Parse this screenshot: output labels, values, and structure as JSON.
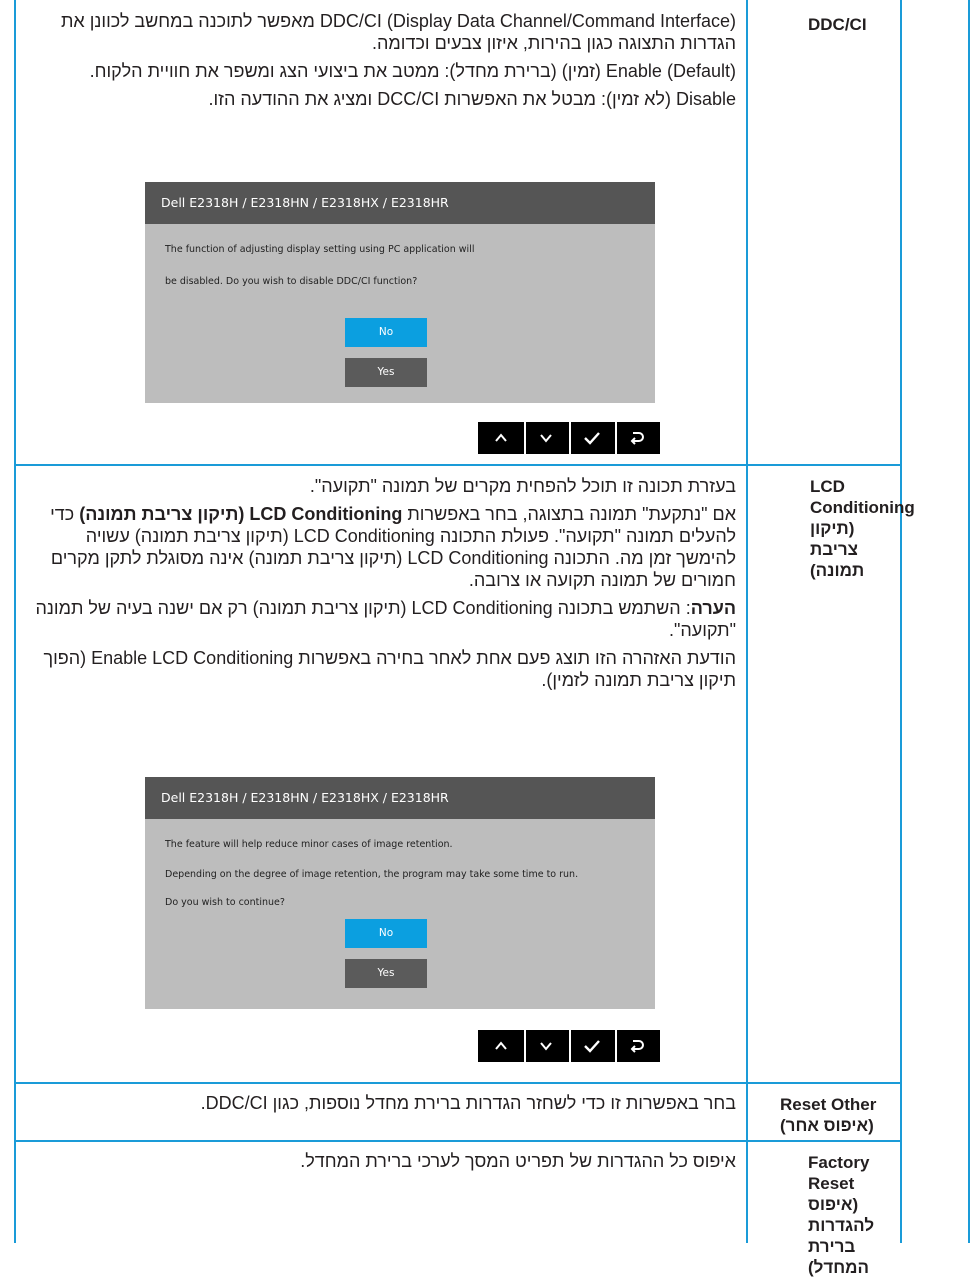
{
  "rows": [
    {
      "heading_en": "DDC/CI",
      "heading_he": "",
      "paragraphs": [
        "(Display Data Channel/Command Interface) DDC/CI מאפשר לתוכנה במחשב לכוונן את הגדרות התצוגה כגון בהירות, איזון צבעים וכדומה.",
        "(Default) Enable (זמין) (ברירת מחדל): ממטב את ביצועי הצג ומשפר את חוויית הלקוח.",
        "Disable (לא זמין): מבטל את האפשרות DCC/CI ומציג את ההודעה הזו."
      ],
      "osd": {
        "title": "Dell E2318H / E2318HN / E2318HX / E2318HR",
        "lines": [
          "The function of adjusting display setting using PC application will",
          "be disabled. Do you wish to disable DDC/CI function?"
        ],
        "no_label": "No",
        "yes_label": "Yes"
      }
    },
    {
      "heading_en": "LCD Conditioning",
      "heading_he": "(תיקון צריבת תמונה)",
      "p1": "בעזרת תכונה זו תוכל להפחית מקרים של תמונה \"תקועה\".",
      "p2_pre": "אם \"נתקעת\" תמונה בתצוגה, בחר באפשרות ",
      "p2_bold": "LCD Conditioning (תיקון צריבת תמונה)",
      "p2_post": " כדי להעלים תמונה \"תקועה\". פעולת התכונה LCD Conditioning (תיקון צריבת תמונה) עשויה להימשך זמן מה. התכונה LCD Conditioning (תיקון צריבת תמונה) אינה מסוגלת לתקן מקרים חמורים של תמונה תקועה או צרובה.",
      "note_label": "הערה",
      "note_text": ": השתמש בתכונה LCD Conditioning (תיקון צריבת תמונה) רק אם ישנה בעיה של תמונה \"תקועה\".",
      "p4": "הודעת האזהרה הזו תוצג פעם אחת לאחר בחירה באפשרות Enable LCD Conditioning (הפוך תיקון צריבת תמונה לזמין).",
      "osd": {
        "title": "Dell E2318H / E2318HN / E2318HX / E2318HR",
        "lines": [
          "The feature will help reduce minor cases of image retention.",
          "Depending on the degree of image retention, the program may take some time to run.",
          "Do you wish to continue?"
        ],
        "no_label": "No",
        "yes_label": "Yes"
      }
    },
    {
      "heading_en": "Reset Other",
      "heading_he": "(איפוס אחר)",
      "text": "בחר באפשרות זו כדי לשחזר הגדרות ברירת מחדל נוספות, כגון DDC/CI."
    },
    {
      "heading_en": "Factory Reset",
      "heading_he": "(איפוס להגדרות ברירת המחדל)",
      "text": "איפוס כל ההגדרות של תפריט המסך לערכי ברירת המחדל."
    }
  ],
  "nav_icons": [
    "chevron-up-icon",
    "chevron-down-icon",
    "check-icon",
    "back-icon"
  ],
  "colors": {
    "rule": "#1a9bd8",
    "osd_bg": "#bdbdbd",
    "osd_title": "#555555",
    "btn_no": "#0b9fe0",
    "btn_yes": "#5b5b5b"
  }
}
